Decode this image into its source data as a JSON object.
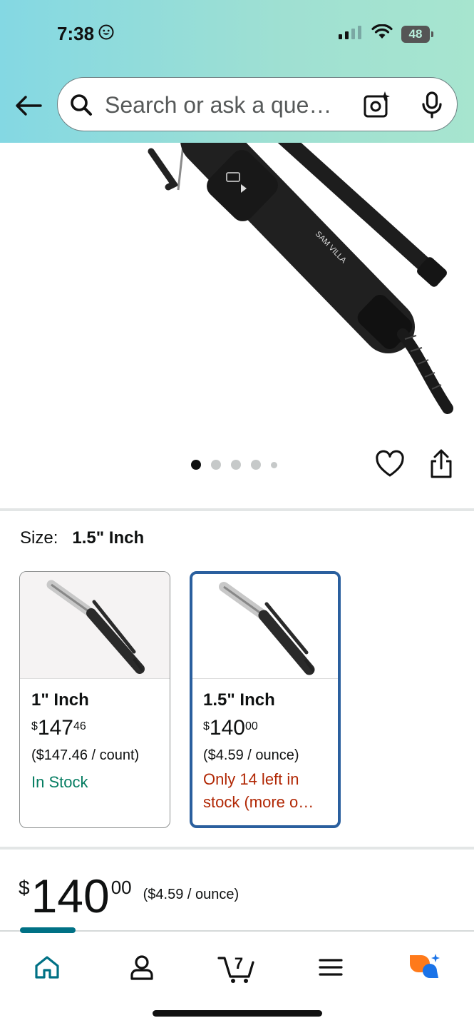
{
  "status_bar": {
    "time": "7:38",
    "battery": "48"
  },
  "search": {
    "placeholder": "Search or ask a que…"
  },
  "product": {
    "brand_on_image": "SAM VILLA",
    "image_count": 5,
    "active_image_index": 0
  },
  "size_selector": {
    "label": "Size:",
    "selected_value": "1.5\" Inch",
    "options": [
      {
        "title": "1\" Inch",
        "price_symbol": "$",
        "price_whole": "147",
        "price_fraction": "46",
        "unit_price": "($147.46 / count)",
        "stock": "In Stock",
        "selected": false
      },
      {
        "title": "1.5\" Inch",
        "price_symbol": "$",
        "price_whole": "140",
        "price_fraction": "00",
        "unit_price": "($4.59 / ounce)",
        "stock": "Only 14 left in stock (more o…",
        "selected": true
      }
    ]
  },
  "main_price": {
    "symbol": "$",
    "whole": "140",
    "fraction": "00",
    "unit_price": "($4.59 / ounce)"
  },
  "tab_bar": {
    "items": [
      "home-icon",
      "account-icon",
      "cart-icon",
      "menu-icon",
      "rufus-icon"
    ],
    "cart_count": "7",
    "active": "home-icon"
  },
  "colors": {
    "header_gradient_start": "#84d8e3",
    "header_gradient_end": "#a7e5cf",
    "selected_border": "#2a5f9e",
    "in_stock": "#067d62",
    "low_stock": "#b12704",
    "active_tab": "#007185"
  }
}
